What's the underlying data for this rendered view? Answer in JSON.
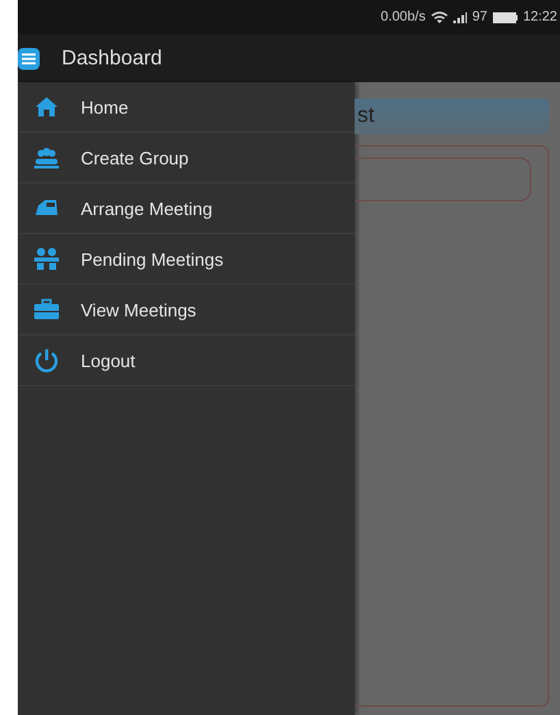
{
  "status_bar": {
    "speed": "0.00b/s",
    "battery": "97",
    "time": "12:22"
  },
  "app_bar": {
    "title": "Dashboard"
  },
  "drawer": {
    "items": [
      {
        "label": "Home"
      },
      {
        "label": "Create Group"
      },
      {
        "label": "Arrange Meeting"
      },
      {
        "label": "Pending Meetings"
      },
      {
        "label": "View Meetings"
      },
      {
        "label": "Logout"
      }
    ]
  },
  "content": {
    "button": "st"
  }
}
